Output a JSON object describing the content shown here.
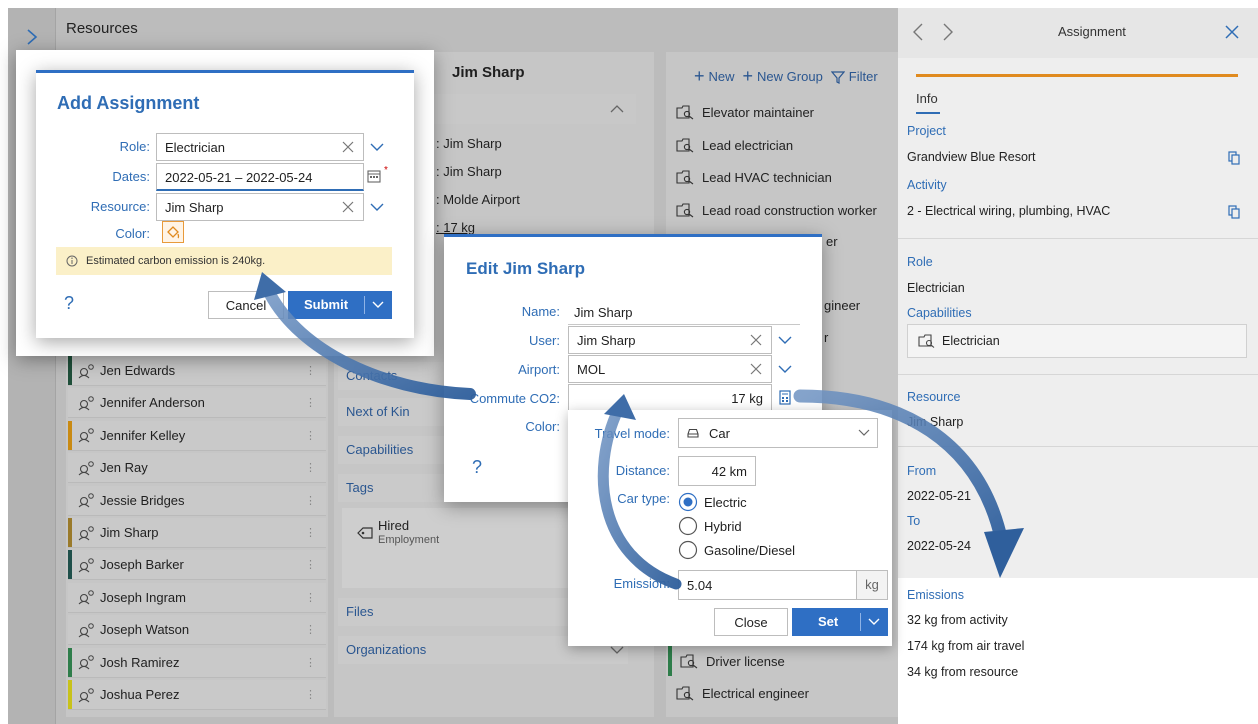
{
  "app": {
    "title": "Resources",
    "people": [
      {
        "name": "Jen Edwards",
        "bar": "#1f4f3a"
      },
      {
        "name": "Jennifer Anderson",
        "bar": ""
      },
      {
        "name": "Jennifer Kelley",
        "bar": "#c98a12"
      },
      {
        "name": "Jen Ray",
        "bar": ""
      },
      {
        "name": "Jessie Bridges",
        "bar": ""
      },
      {
        "name": "Jim Sharp",
        "bar": "#9a7a2a"
      },
      {
        "name": "Joseph Barker",
        "bar": "#1f4f4a"
      },
      {
        "name": "Joseph Ingram",
        "bar": ""
      },
      {
        "name": "Joseph Watson",
        "bar": ""
      },
      {
        "name": "Josh Ramirez",
        "bar": "#2e7d4a"
      },
      {
        "name": "Joshua Perez",
        "bar": "#c8c21a"
      }
    ],
    "detail": {
      "header": "Jim Sharp",
      "props": [
        ": Jim Sharp",
        ": Jim Sharp",
        ": Molde Airport",
        ": 17 kg"
      ],
      "sections": [
        "Contacts",
        "Next of Kin",
        "Capabilities",
        "Tags",
        "Files",
        "Organizations"
      ],
      "tag_name": "Hired",
      "tag_category": "Employment"
    },
    "capabilities_toolbar": {
      "new": "New",
      "new_group": "New Group",
      "filter": "Filter"
    },
    "capabilities_top": [
      "Elevator maintainer",
      "Lead electrician",
      "Lead HVAC technician",
      "Lead road construction worker"
    ],
    "capabilities_partial": [
      "er",
      "gineer",
      "r"
    ],
    "capabilities_bottom": [
      "Driver license",
      "Electrical engineer"
    ]
  },
  "assignment_panel": {
    "title": "Assignment",
    "tab": "Info",
    "project_label": "Project",
    "project_value": "Grandview Blue Resort",
    "activity_label": "Activity",
    "activity_value": "2 - Electrical wiring, plumbing, HVAC",
    "role_label": "Role",
    "role_value": "Electrician",
    "capabilities_label": "Capabilities",
    "capability_value": "Electrician",
    "resource_label": "Resource",
    "resource_value": "Jim Sharp",
    "from_label": "From",
    "from_value": "2022-05-21",
    "to_label": "To",
    "to_value": "2022-05-24",
    "emissions_label": "Emissions",
    "emissions": [
      "32 kg from activity",
      "174 kg from air travel",
      "34 kg from resource"
    ],
    "accent": "#e08a1e"
  },
  "add_assignment": {
    "title": "Add Assignment",
    "role_label": "Role:",
    "role_value": "Electrician",
    "dates_label": "Dates:",
    "dates_value": "2022-05-21 – 2022-05-24",
    "resource_label": "Resource:",
    "resource_value": "Jim Sharp",
    "color_label": "Color:",
    "info_text": "Estimated carbon emission is 240kg.",
    "help": "?",
    "cancel": "Cancel",
    "submit": "Submit"
  },
  "edit_dialog": {
    "title": "Edit Jim Sharp",
    "name_label": "Name:",
    "name_value": "Jim Sharp",
    "user_label": "User:",
    "user_value": "Jim Sharp",
    "airport_label": "Airport:",
    "airport_value": "MOL",
    "commute_label": "Commute CO2:",
    "commute_value": "17 kg",
    "color_label": "Color:",
    "help": "?"
  },
  "calc_popup": {
    "travel_label": "Travel mode:",
    "travel_value": "Car",
    "distance_label": "Distance:",
    "distance_value": "42 km",
    "car_type_label": "Car type:",
    "car_types": [
      "Electric",
      "Hybrid",
      "Gasoline/Diesel"
    ],
    "selected_car_type": "Electric",
    "emission_label": "Emission:",
    "emission_value": "5.04",
    "emission_unit": "kg",
    "close": "Close",
    "set": "Set"
  }
}
